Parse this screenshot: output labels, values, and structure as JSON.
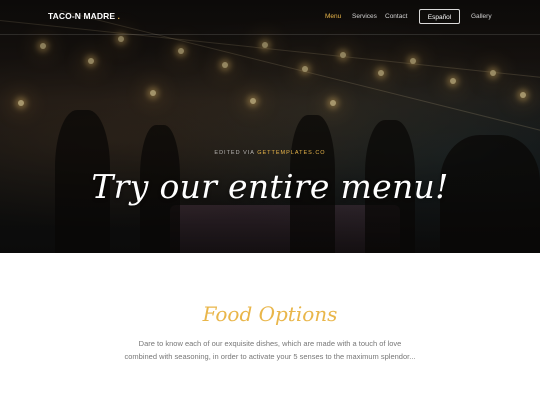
{
  "nav": {
    "brand": "TACO-N MADRE",
    "brand_mark": ".",
    "links": [
      {
        "label": "Menu",
        "active": true
      },
      {
        "label": "Services",
        "active": false
      },
      {
        "label": "Contact",
        "active": false
      }
    ],
    "language_button": "Español",
    "gallery": "Gallery"
  },
  "hero": {
    "kicker_prefix": "EDITED VIA ",
    "kicker_link": "GETTEMPLATES.CO",
    "title": "Try our entire menu!"
  },
  "section": {
    "title": "Food Options",
    "text": "Dare to know each of our exquisite dishes, which are made with a touch of love combined with seasoning, in order to activate your 5 senses to the maximum splendor..."
  },
  "colors": {
    "accent": "#e9b64a",
    "text_muted": "#777777",
    "hero_dark": "#1a1613"
  }
}
